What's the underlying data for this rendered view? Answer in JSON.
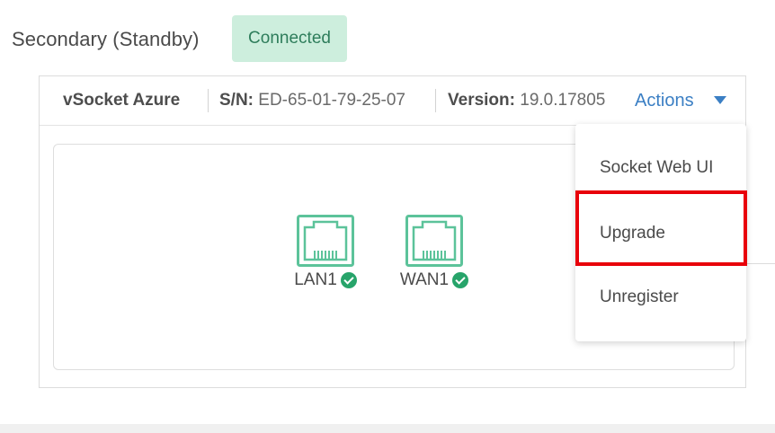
{
  "header": {
    "title": "Secondary (Standby)",
    "status_badge": "Connected"
  },
  "info_bar": {
    "device": "vSocket Azure",
    "serial_label": "S/N:",
    "serial_value": "ED-65-01-79-25-07",
    "version_label": "Version:",
    "version_value": "19.0.17805",
    "actions_label": "Actions"
  },
  "ports": [
    {
      "label": "LAN1",
      "status": "connected",
      "icon": "ethernet-port-icon"
    },
    {
      "label": "WAN1",
      "status": "connected",
      "icon": "ethernet-port-icon"
    }
  ],
  "actions_menu": {
    "items": [
      "Socket Web UI",
      "Upgrade",
      "Unregister"
    ],
    "highlighted_item": "Upgrade"
  },
  "colors": {
    "badge_bg": "#cdeedd",
    "badge_text": "#2e7d5b",
    "link": "#3b7fc4",
    "port_icon": "#5cc39a",
    "check": "#27a46a",
    "highlight_border": "#e8000a"
  }
}
